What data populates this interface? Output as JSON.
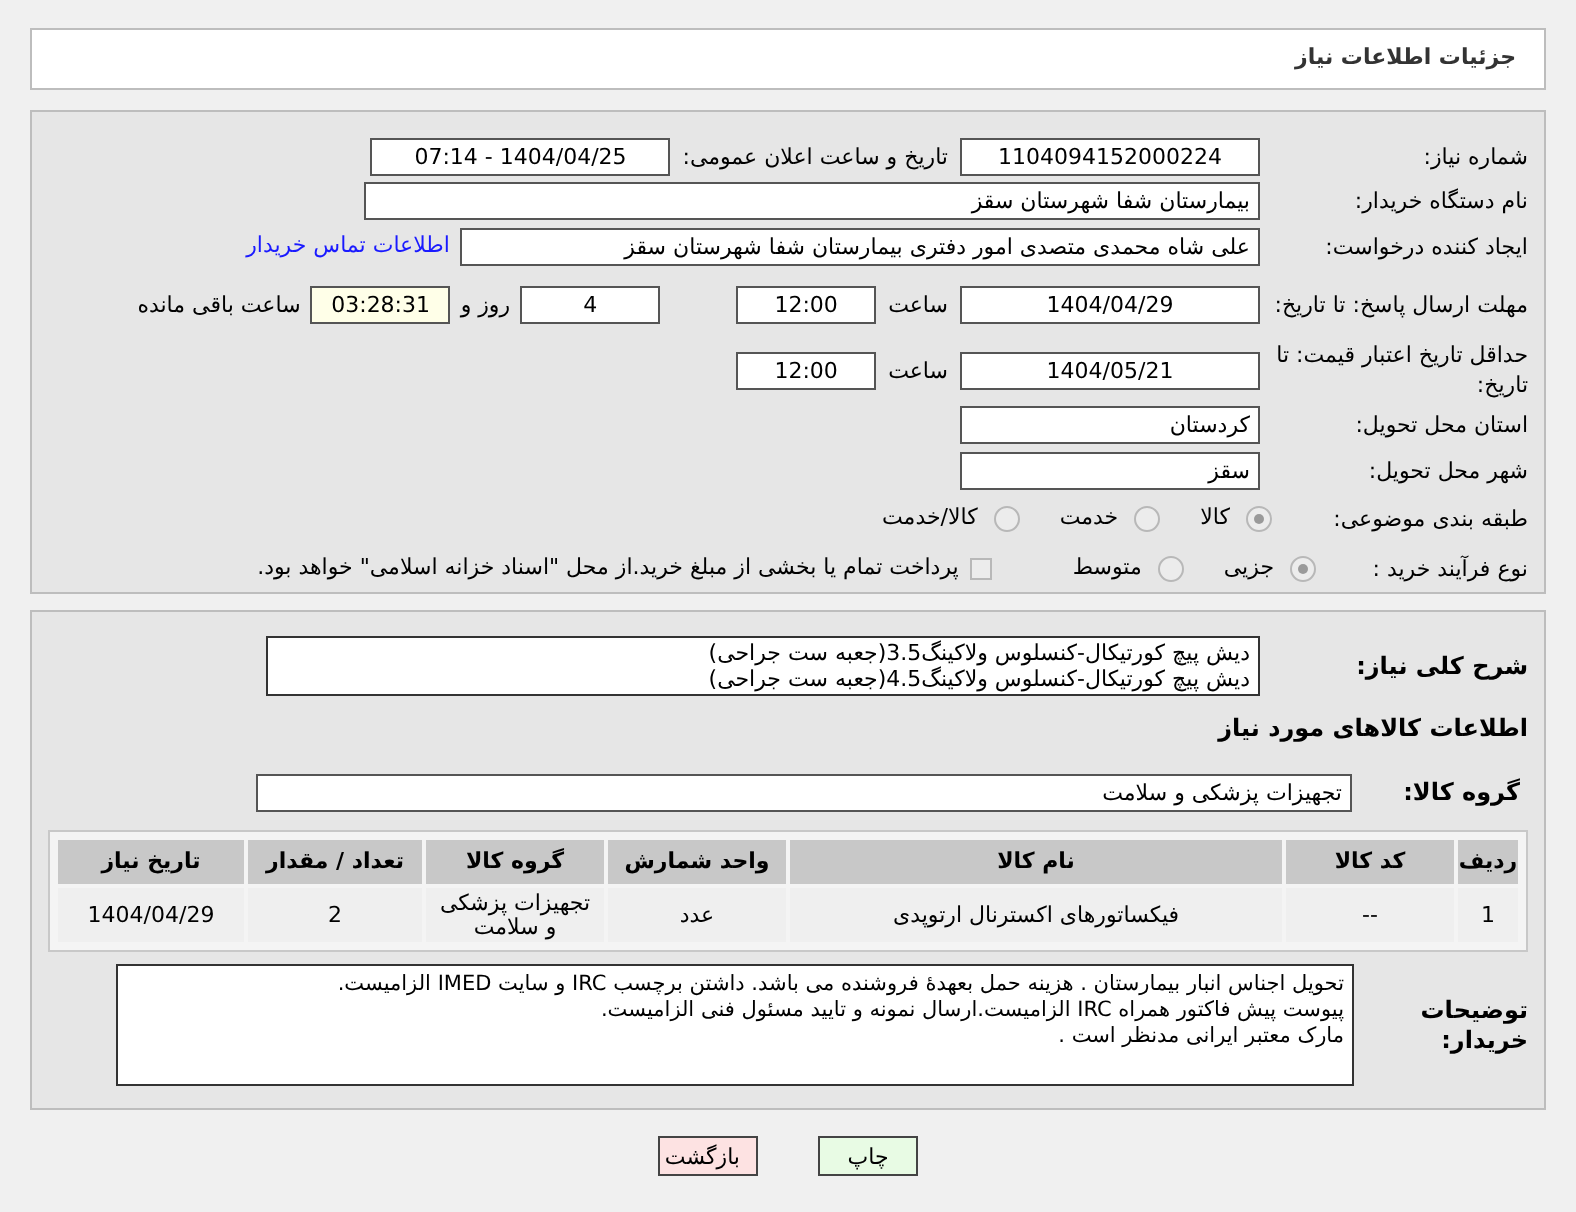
{
  "header": {
    "title": "جزئیات اطلاعات نیاز"
  },
  "need_number": {
    "label": "شماره نیاز:",
    "value": "1104094152000224"
  },
  "announce": {
    "label": "تاریخ و ساعت اعلان عمومی:",
    "value": "1404/04/25 - 07:14"
  },
  "buyer_org": {
    "label": "نام دستگاه خریدار:",
    "value": "بیمارستان شفا شهرستان سقز"
  },
  "requester": {
    "label": "ایجاد کننده درخواست:",
    "value": "علی شاه محمدی متصدی امور دفتری بیمارستان شفا شهرستان سقز",
    "link": "اطلاعات تماس خریدار"
  },
  "reply_deadline": {
    "label": "مهلت ارسال پاسخ: تا تاریخ:",
    "date": "1404/04/29",
    "time_label": "ساعت",
    "time": "12:00",
    "days": "4",
    "days_label": "روز و",
    "remaining": "03:28:31",
    "remaining_label": "ساعت باقی مانده"
  },
  "price_validity": {
    "label": "حداقل تاریخ اعتبار قیمت: تا تاریخ:",
    "date": "1404/05/21",
    "time_label": "ساعت",
    "time": "12:00"
  },
  "province": {
    "label": "استان محل تحویل:",
    "value": "کردستان"
  },
  "city": {
    "label": "شهر محل تحویل:",
    "value": "سقز"
  },
  "category": {
    "label": "طبقه بندی موضوعی:",
    "options": [
      {
        "label": "کالا",
        "selected": true
      },
      {
        "label": "خدمت",
        "selected": false
      },
      {
        "label": "کالا/خدمت",
        "selected": false
      }
    ]
  },
  "process": {
    "label": "نوع فرآیند خرید :",
    "options": [
      {
        "label": "جزیی",
        "selected": true
      },
      {
        "label": "متوسط",
        "selected": false
      }
    ],
    "payment": {
      "checked": false,
      "text": "پرداخت تمام یا بخشی از مبلغ خرید.از محل \"اسناد خزانه اسلامی\" خواهد بود."
    }
  },
  "description": {
    "label": "شرح کلی نیاز:",
    "lines": [
      "دیش پیچ کورتیکال-کنسلوس ولاکینگ3.5(جعبه ست جراحی)",
      "دیش پیچ کورتیکال-کنسلوس ولاکینگ4.5(جعبه ست جراحی)"
    ]
  },
  "goods_heading": "اطلاعات کالاهای مورد نیاز",
  "goods_group": {
    "label": "گروه کالا:",
    "value": "تجهیزات پزشکی و سلامت"
  },
  "table": {
    "columns": [
      "ردیف",
      "کد کالا",
      "نام کالا",
      "واحد شمارش",
      "گروه کالا",
      "تعداد / مقدار",
      "تاریخ نیاز"
    ],
    "rows": [
      [
        "1",
        "--",
        "فیکساتورهای اکسترنال ارتوپدی",
        "عدد",
        "تجهیزات پزشکی و سلامت",
        "2",
        "1404/04/29"
      ]
    ]
  },
  "notes": {
    "label": "توضیحات خریدار:",
    "lines": [
      "تحویل اجناس  انبار بیمارستان . هزینه حمل بعهدهٔ فروشنده می باشد.  داشتن برچسب IRC  و سایت  IMED  الزامیست.",
      "پیوست پیش فاکتور همراه IRC  الزامیست.ارسال نمونه و تایید مسئول فنی الزامیست.",
      "مارک معتبر ایرانی مدنظر است ."
    ]
  },
  "buttons": [
    {
      "label": "چاپ",
      "kind": "print"
    },
    {
      "label": "بازگشت",
      "kind": "back"
    }
  ]
}
